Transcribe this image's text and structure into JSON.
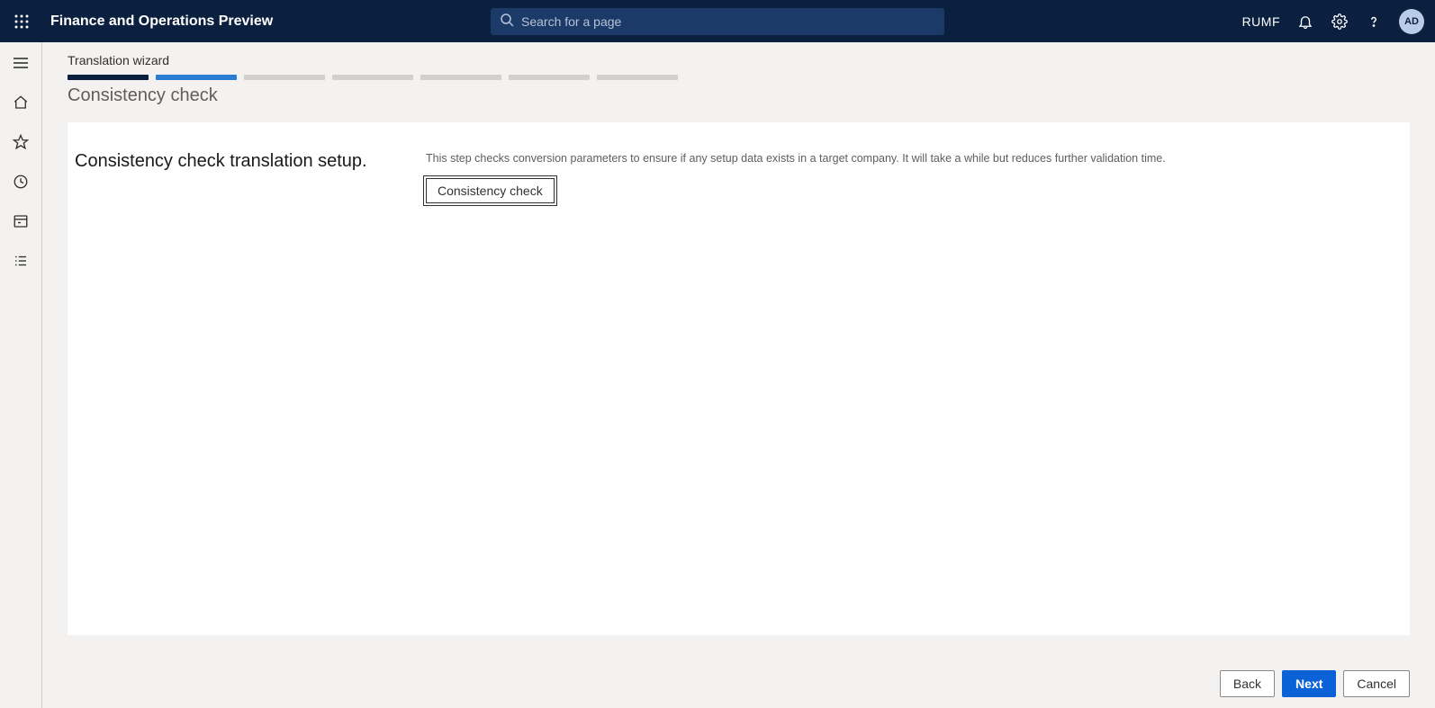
{
  "header": {
    "app_title": "Finance and Operations Preview",
    "search_placeholder": "Search for a page",
    "company_code": "RUMF",
    "avatar_initials": "AD"
  },
  "breadcrumb": "Translation wizard",
  "wizard": {
    "title": "Consistency check",
    "total_steps": 7,
    "current_step": 2
  },
  "content": {
    "heading": "Consistency check translation setup.",
    "description": "This step checks conversion parameters to ensure if any setup data exists in a target company. It will take a while but reduces further validation time.",
    "action_label": "Consistency check"
  },
  "footer": {
    "back": "Back",
    "next": "Next",
    "cancel": "Cancel"
  }
}
